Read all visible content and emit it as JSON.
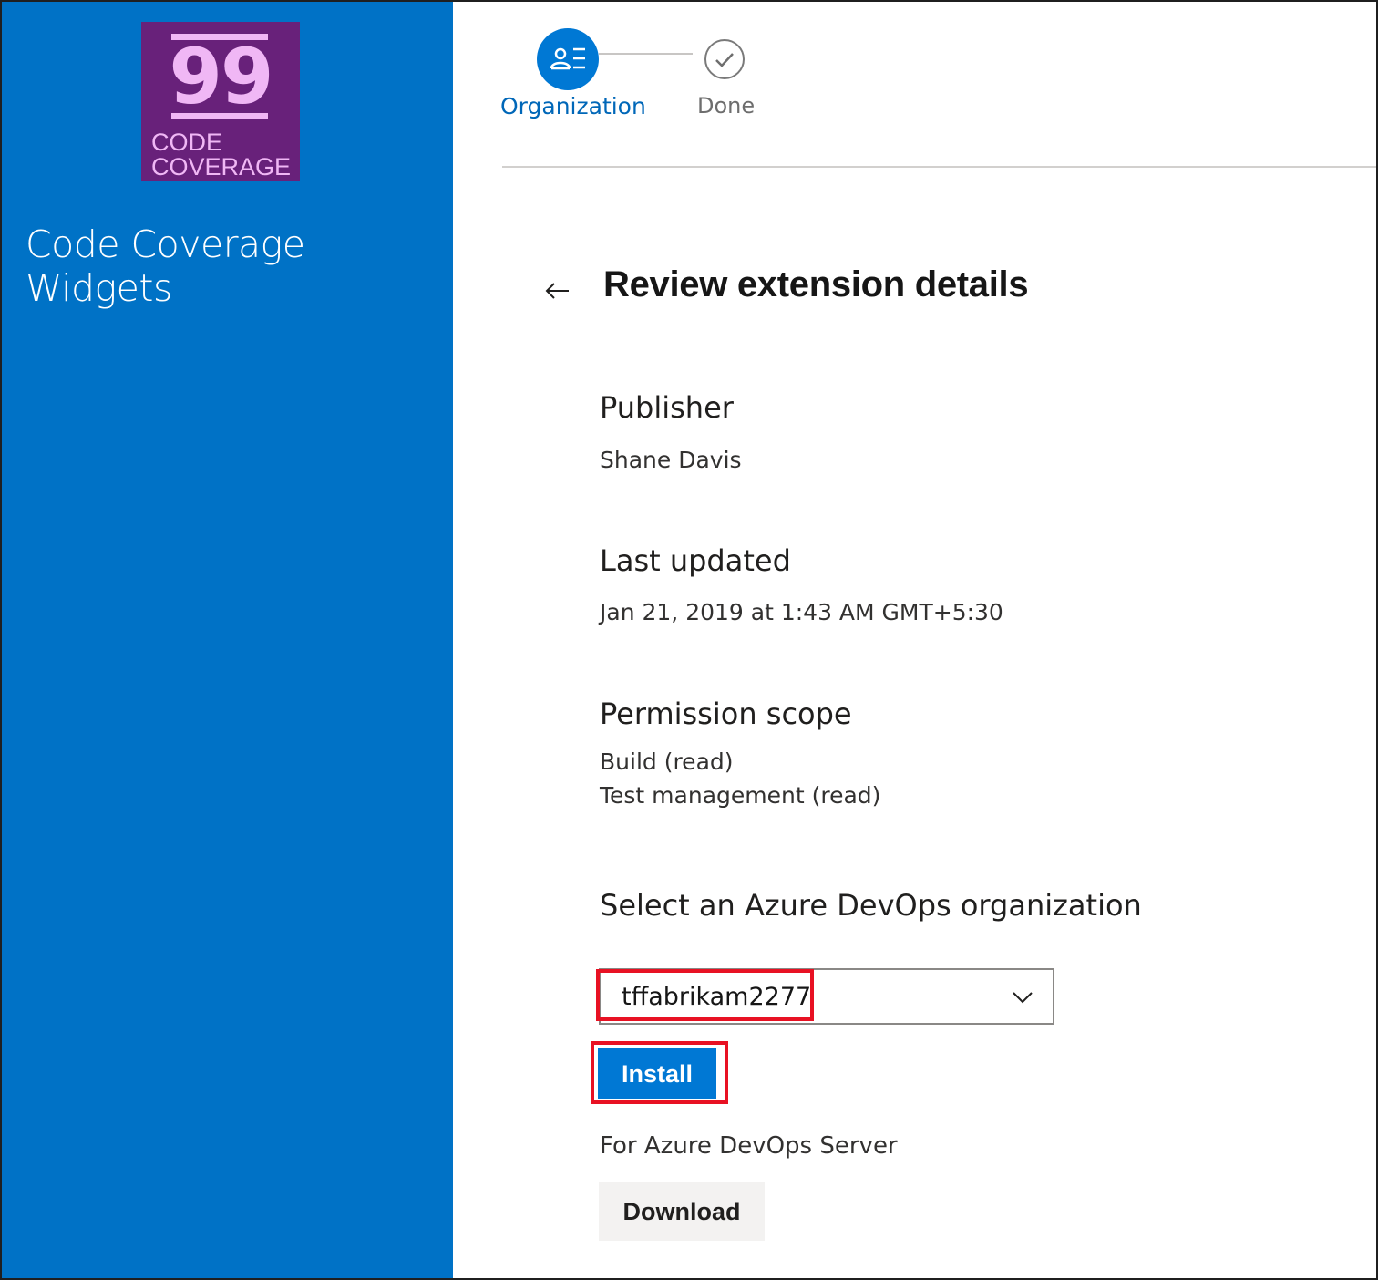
{
  "sidebar": {
    "logo": {
      "number": "99",
      "line1": "CODE",
      "line2": "COVERAGE"
    },
    "product_name": "Code Coverage Widgets"
  },
  "stepper": {
    "steps": [
      {
        "label": "Organization",
        "state": "active",
        "icon": "organization-list-icon"
      },
      {
        "label": "Done",
        "state": "pending",
        "icon": "checkmark-circle-icon"
      }
    ]
  },
  "main": {
    "title": "Review extension details",
    "sections": {
      "publisher": {
        "heading": "Publisher",
        "value": "Shane Davis"
      },
      "last_updated": {
        "heading": "Last updated",
        "value": "Jan 21, 2019 at 1:43 AM GMT+5:30"
      },
      "permission_scope": {
        "heading": "Permission scope",
        "values": [
          "Build (read)",
          "Test management (read)"
        ]
      }
    },
    "org_select": {
      "label": "Select an Azure DevOps organization",
      "value": "tffabrikam2277"
    },
    "install_label": "Install",
    "server_label": "For Azure DevOps Server",
    "download_label": "Download"
  },
  "colors": {
    "sidebar_bg": "#0072c6",
    "logo_bg": "#68217a",
    "logo_fg": "#f0b7f5",
    "primary": "#0078d4",
    "highlight": "#e81123"
  }
}
